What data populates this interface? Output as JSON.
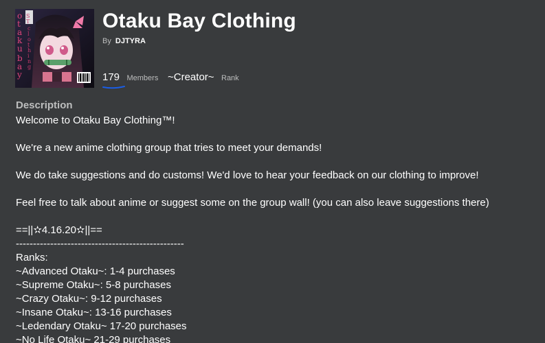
{
  "group": {
    "name": "Otaku Bay Clothing",
    "by_label": "By",
    "owner": "DJTYRA",
    "emblem_text_left": "otaku bay",
    "emblem_text_right": "clothing"
  },
  "stats": {
    "members_value": "179",
    "members_label": "Members",
    "rank_value": "~Creator~",
    "rank_label": "Rank"
  },
  "colors": {
    "background": "#393b3d",
    "underline": "#1a5ee8",
    "muted_text": "#bdbebe"
  },
  "description": {
    "heading": "Description",
    "lines": [
      "Welcome to Otaku Bay Clothing™!",
      "",
      "We're a new anime clothing group that tries to meet your demands!",
      "",
      "We do take suggestions and do customs! We'd love to hear your feedback on our clothing to improve!",
      "",
      "Feel free to talk about anime or suggest some on the group wall! (you can also leave suggestions there)",
      "",
      "==||✫4.16.20✫||==",
      "-------------------------------------------------",
      "Ranks:",
      "~Advanced Otaku~: 1-4 purchases",
      "~Supreme Otaku~: 5-8 purchases",
      "~Crazy Otaku~: 9-12 purchases",
      "~Insane Otaku~: 13-16 purchases",
      "~Ledendary Otaku~ 17-20 purchases",
      "~No Life Otaku~ 21-29 purchases"
    ]
  }
}
